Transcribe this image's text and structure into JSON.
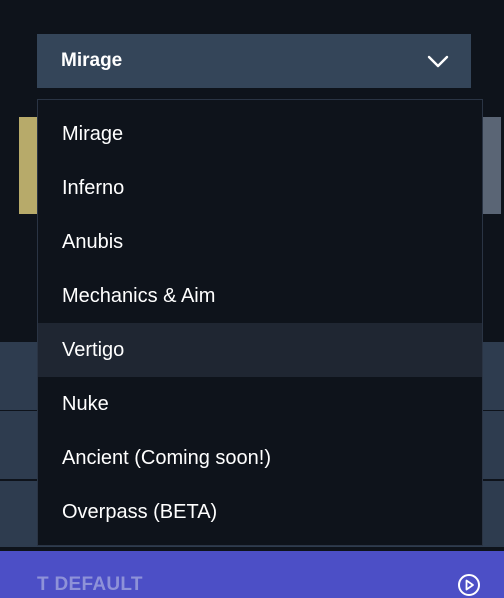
{
  "select": {
    "value": "Mirage",
    "chevron_icon": "chevron-down-icon"
  },
  "menu": {
    "options": [
      {
        "label": "Mirage"
      },
      {
        "label": "Inferno"
      },
      {
        "label": "Anubis"
      },
      {
        "label": "Mechanics & Aim"
      },
      {
        "label": "Vertigo",
        "hovered": true
      },
      {
        "label": "Nuke"
      },
      {
        "label": "Ancient (Coming soon!)"
      },
      {
        "label": "Overpass (BETA)"
      }
    ]
  },
  "bottom_bar": {
    "label": "T DEFAULT",
    "icon": "play-circle-icon"
  },
  "colors": {
    "page_bg": "#0e131b",
    "select_bg": "#344559",
    "option_hover_bg": "#1f2632",
    "accent_gold": "#b7aa6a",
    "bar_purple": "#4c4fc6",
    "bar_text": "#8e92d8"
  }
}
